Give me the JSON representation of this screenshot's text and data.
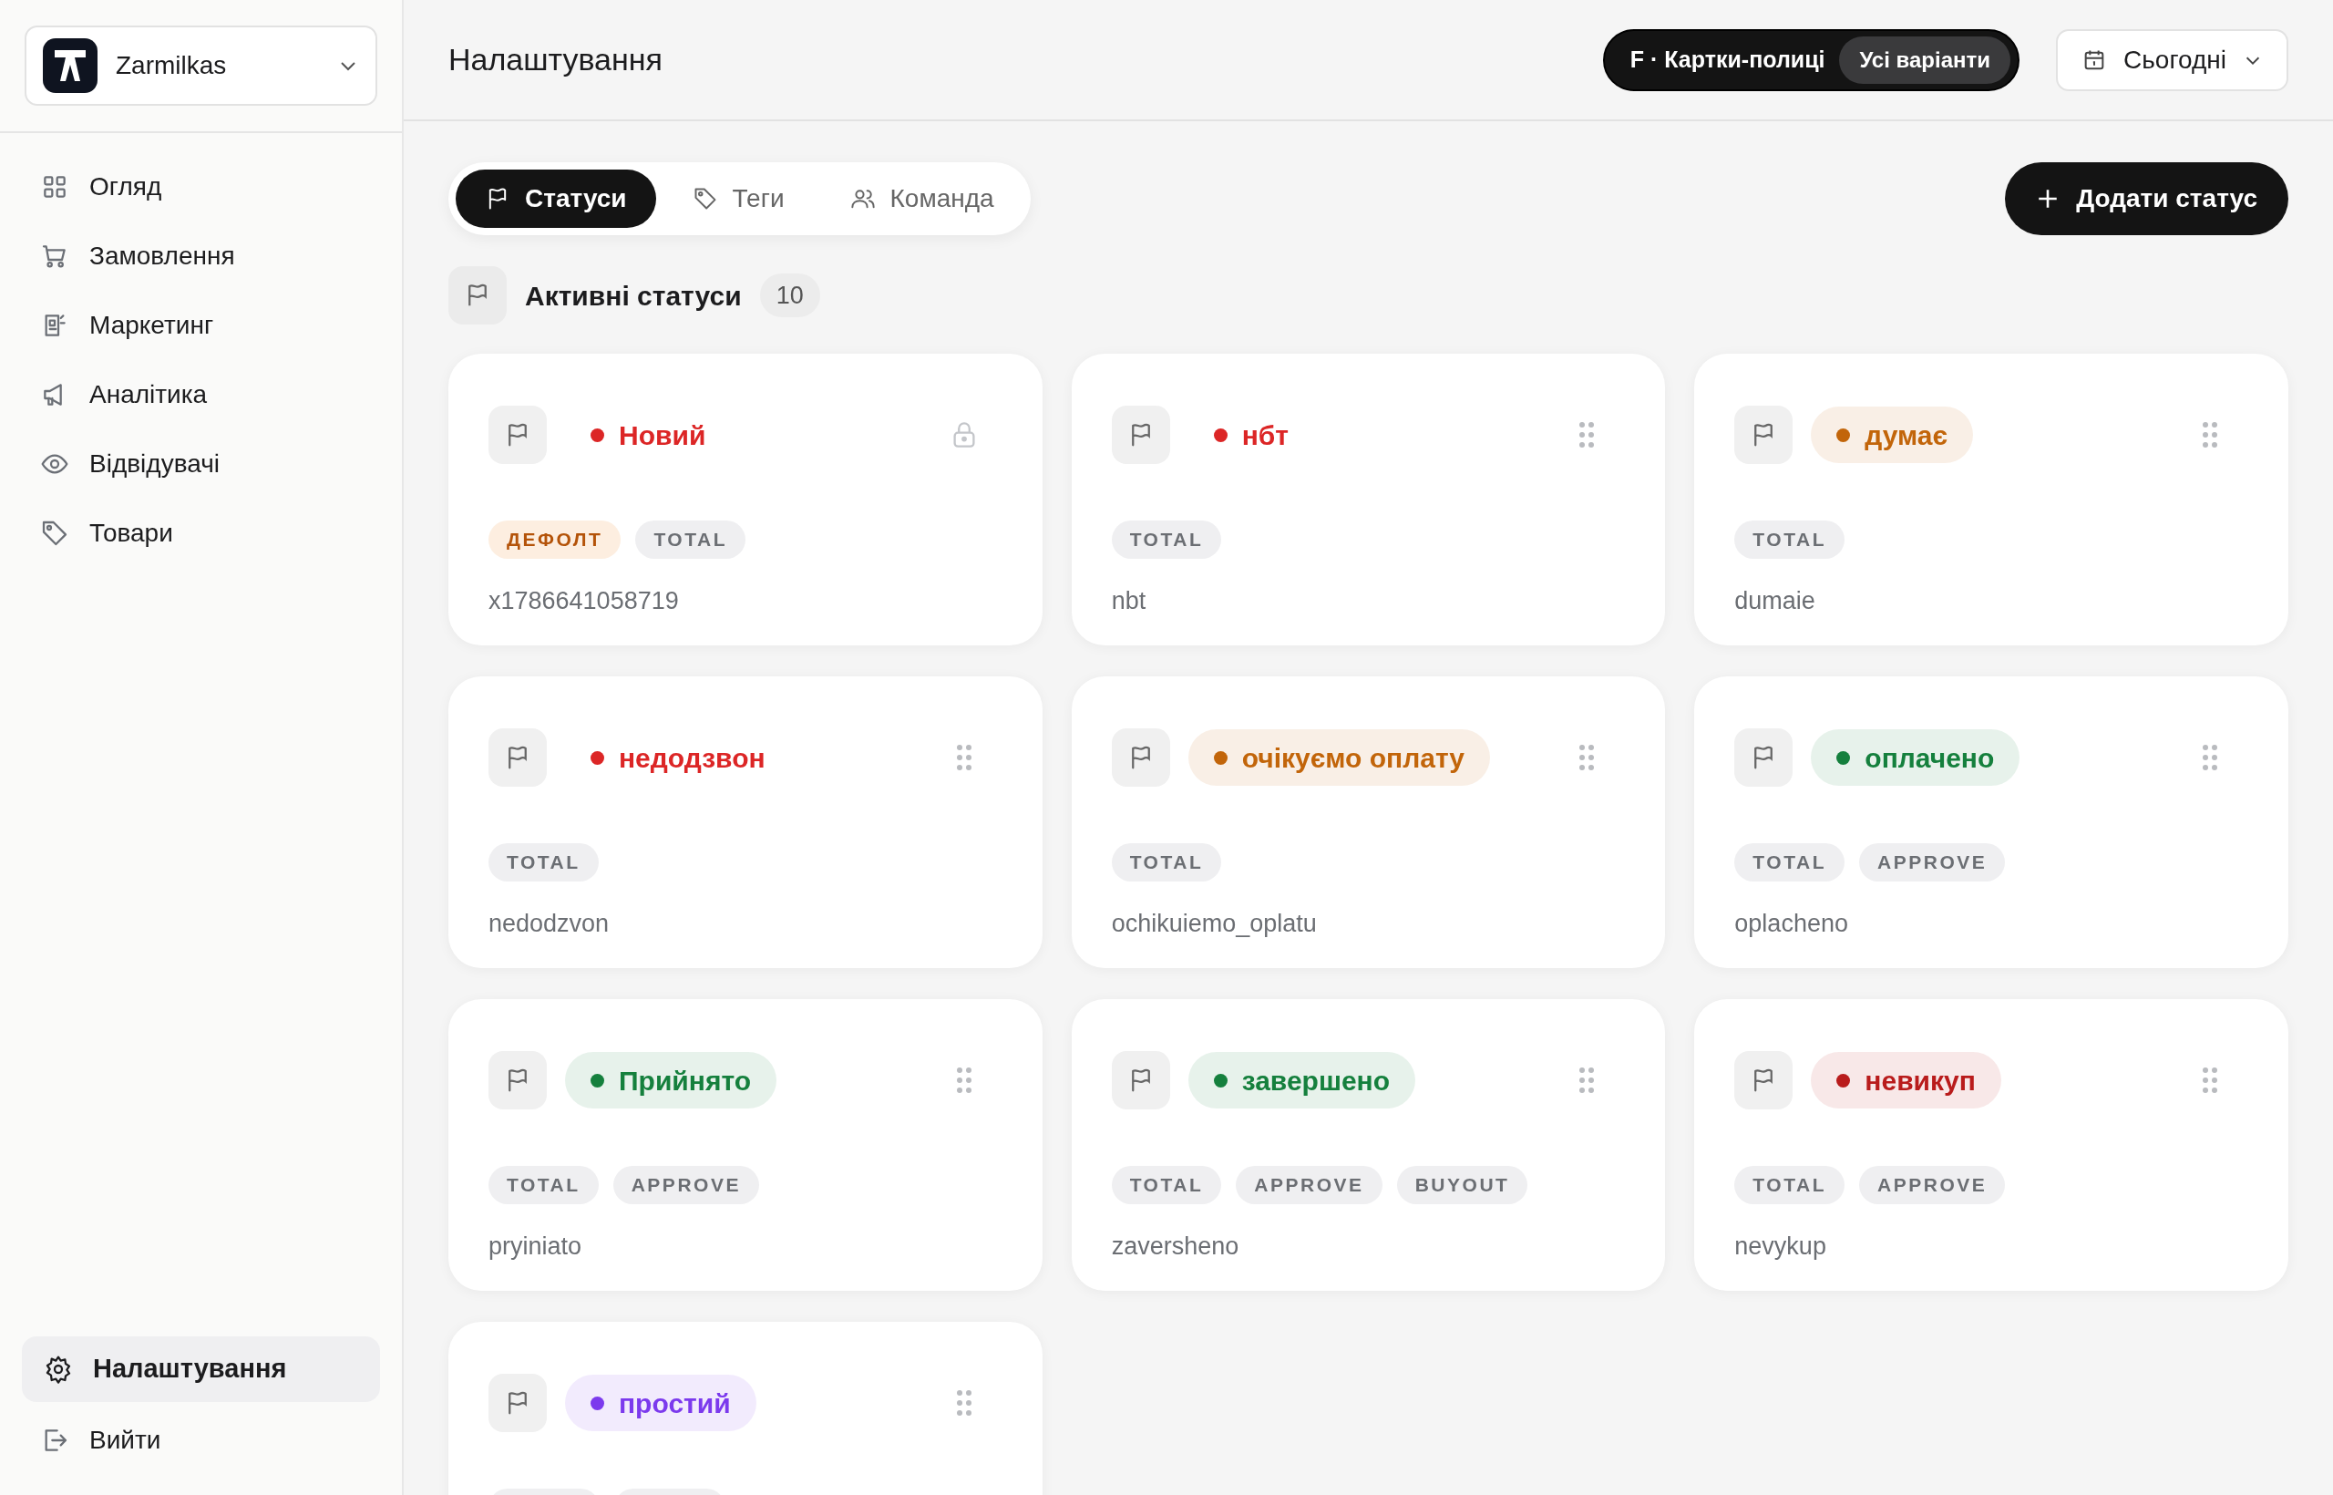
{
  "brand": {
    "name": "Zarmilkas"
  },
  "nav": [
    {
      "label": "Огляд",
      "kind": "grid",
      "selected": false
    },
    {
      "label": "Замовлення",
      "kind": "cart",
      "selected": false
    },
    {
      "label": "Маркетинг",
      "kind": "news",
      "selected": false
    },
    {
      "label": "Аналітика",
      "kind": "megaphone",
      "selected": false
    },
    {
      "label": "Відвідувачі",
      "kind": "eye",
      "selected": false
    },
    {
      "label": "Товари",
      "kind": "tag",
      "selected": false
    }
  ],
  "nav_bottom": [
    {
      "label": "Налаштування",
      "kind": "gear",
      "selected": true
    },
    {
      "label": "Вийти",
      "kind": "logout",
      "selected": false
    }
  ],
  "header": {
    "title": "Налаштування",
    "variant_label": "F · Картки-полиці",
    "variant_button": "Усі варіанти",
    "date_button": "Сьогодні"
  },
  "tabs": [
    {
      "label": "Статуси",
      "kind": "flag",
      "selected": true
    },
    {
      "label": "Теги",
      "kind": "tag",
      "selected": false
    },
    {
      "label": "Команда",
      "kind": "users",
      "selected": false
    }
  ],
  "add_button": "Додати статус",
  "section": {
    "title": "Активні статуси",
    "count": "10"
  },
  "statuses": [
    {
      "name": "Новий",
      "color": "#dc2626",
      "filled": false,
      "locked": true,
      "tags": [
        {
          "label": "ДЕФОЛТ",
          "kind": "default"
        },
        {
          "label": "TOTAL",
          "kind": "plain"
        }
      ],
      "code": "x1786641058719"
    },
    {
      "name": "нбт",
      "color": "#dc2626",
      "filled": false,
      "locked": false,
      "tags": [
        {
          "label": "TOTAL",
          "kind": "plain"
        }
      ],
      "code": "nbt"
    },
    {
      "name": "думає",
      "color": "#c2650a",
      "filled": true,
      "locked": false,
      "tags": [
        {
          "label": "TOTAL",
          "kind": "plain"
        }
      ],
      "code": "dumaie"
    },
    {
      "name": "недодзвон",
      "color": "#dc2626",
      "filled": false,
      "locked": false,
      "tags": [
        {
          "label": "TOTAL",
          "kind": "plain"
        }
      ],
      "code": "nedodzvon"
    },
    {
      "name": "очікуємо оплату",
      "color": "#c2650a",
      "filled": true,
      "locked": false,
      "tags": [
        {
          "label": "TOTAL",
          "kind": "plain"
        }
      ],
      "code": "ochikuiemo_oplatu"
    },
    {
      "name": "оплачено",
      "color": "#15803d",
      "filled": true,
      "locked": false,
      "tags": [
        {
          "label": "TOTAL",
          "kind": "plain"
        },
        {
          "label": "APPROVE",
          "kind": "plain"
        }
      ],
      "code": "oplacheno"
    },
    {
      "name": "Прийнято",
      "color": "#15803d",
      "filled": true,
      "locked": false,
      "tags": [
        {
          "label": "TOTAL",
          "kind": "plain"
        },
        {
          "label": "APPROVE",
          "kind": "plain"
        }
      ],
      "code": "pryiniato"
    },
    {
      "name": "завершено",
      "color": "#15803d",
      "filled": true,
      "locked": false,
      "tags": [
        {
          "label": "TOTAL",
          "kind": "plain"
        },
        {
          "label": "APPROVE",
          "kind": "plain"
        },
        {
          "label": "BUYOUT",
          "kind": "plain"
        }
      ],
      "code": "zaversheno"
    },
    {
      "name": "невикуп",
      "color": "#b91c1c",
      "filled": true,
      "locked": false,
      "tags": [
        {
          "label": "TOTAL",
          "kind": "plain"
        },
        {
          "label": "APPROVE",
          "kind": "plain"
        }
      ],
      "code": "nevykup"
    },
    {
      "name": "простий",
      "color": "#7c3aed",
      "filled": true,
      "locked": false,
      "tags": [
        {
          "kind": "plain"
        },
        {
          "kind": "plain"
        }
      ]
    }
  ]
}
